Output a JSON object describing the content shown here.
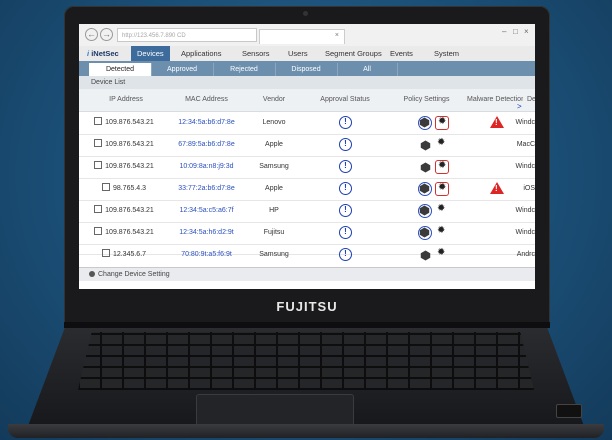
{
  "browser": {
    "url": "http://123.456.7.890 CD",
    "tab_close": "×",
    "win_controls": [
      "–",
      "□",
      "×"
    ],
    "nav_back": "←",
    "nav_forward": "→"
  },
  "app": {
    "logo_i": "i",
    "logo_name": "iNetSec",
    "menu": [
      "Devices",
      "Applications",
      "Sensors",
      "Users",
      "Segment Groups",
      "Events",
      "System"
    ],
    "active_menu": "Devices"
  },
  "subtabs": [
    "Detected",
    "Approved",
    "Rejected",
    "Disposed",
    "All"
  ],
  "active_subtab": "Detected",
  "section_title": "Device List",
  "columns": [
    "IP Address",
    "MAC Address",
    "Vendor",
    "Approval Status",
    "Policy Settings",
    "Malware Detection Result",
    "Device T"
  ],
  "scroll_right": ">",
  "rows": [
    {
      "ip": "109.876.543.21",
      "mac": "12:34:5a:b6:d7:8e",
      "vendor": "Lenovo",
      "device": "Windc",
      "approval": "!",
      "malware": true,
      "shield_ring": true,
      "gear_boxed": true
    },
    {
      "ip": "109.876.543.21",
      "mac": "67:89:5a:b6:d7:8e",
      "vendor": "Apple",
      "device": "MacC",
      "approval": "!",
      "malware": false,
      "shield_ring": false,
      "gear_boxed": false
    },
    {
      "ip": "109.876.543.21",
      "mac": "10:09:8a:n8:j9:3d",
      "vendor": "Samsung",
      "device": "Windc",
      "approval": "!",
      "malware": false,
      "shield_ring": false,
      "gear_boxed": true
    },
    {
      "ip": "98.765.4.3",
      "mac": "33:77:2a:b6:d7:8e",
      "vendor": "Apple",
      "device": "iOS",
      "approval": "!",
      "malware": true,
      "shield_ring": true,
      "gear_boxed": true
    },
    {
      "ip": "109.876.543.21",
      "mac": "12:34:5a:c5:a6:7f",
      "vendor": "HP",
      "device": "Windc",
      "approval": "!",
      "malware": false,
      "shield_ring": true,
      "gear_boxed": false
    },
    {
      "ip": "109.876.543.21",
      "mac": "12:34:5a:h6:d2:9t",
      "vendor": "Fujitsu",
      "device": "Windc",
      "approval": "!",
      "malware": false,
      "shield_ring": true,
      "gear_boxed": false
    },
    {
      "ip": "12.345.6.7",
      "mac": "70:80:9t:a5:f6:9t",
      "vendor": "Samsung",
      "device": "Andrc",
      "approval": "!",
      "malware": false,
      "shield_ring": false,
      "gear_boxed": false
    }
  ],
  "malware_icon_text": "!",
  "gear_glyph": "✹",
  "change_setting": "Change Device Setting",
  "laptop_brand": "FUJITSU",
  "colors": {
    "accent": "#3d6b9c",
    "alert": "#dc2626",
    "link": "#2a4fbf",
    "icon": "#1c3fb5"
  }
}
